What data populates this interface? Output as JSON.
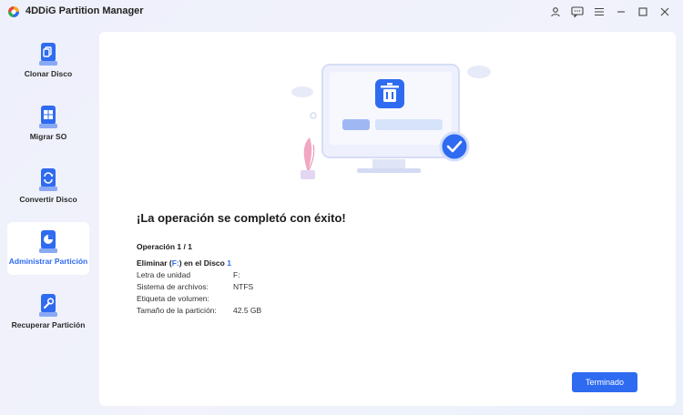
{
  "app": {
    "title": "4DDiG Partition Manager"
  },
  "window_controls": {
    "icons": [
      "user-icon",
      "feedback-icon",
      "menu-icon",
      "minimize-icon",
      "maximize-icon",
      "close-icon"
    ]
  },
  "sidebar": {
    "items": [
      {
        "label": "Clonar Disco",
        "icon": "clone-disk-icon",
        "active": false
      },
      {
        "label": "Migrar SO",
        "icon": "migrate-os-icon",
        "active": false
      },
      {
        "label": "Convertir Disco",
        "icon": "convert-disk-icon",
        "active": false
      },
      {
        "label": "Administrar Partición",
        "icon": "manage-partition-icon",
        "active": true
      },
      {
        "label": "Recuperar Partición",
        "icon": "recover-partition-icon",
        "active": false
      }
    ]
  },
  "main": {
    "title": "¡La operación se completó con éxito!",
    "operation_count": "Operación 1 / 1",
    "operation": {
      "prefix": "Eliminar (",
      "drive": "F:",
      "middle": ") en el Disco ",
      "disk": "1"
    },
    "details": [
      {
        "label": "Letra de unidad",
        "value": "F:"
      },
      {
        "label": "Sistema de archivos:",
        "value": "NTFS"
      },
      {
        "label": "Etiqueta de volumen:",
        "value": ""
      },
      {
        "label": "Tamaño de la partición:",
        "value": "42.5 GB"
      }
    ],
    "done_button": "Terminado"
  },
  "colors": {
    "accent": "#2f6bf0",
    "success": "#2f6bf0"
  }
}
